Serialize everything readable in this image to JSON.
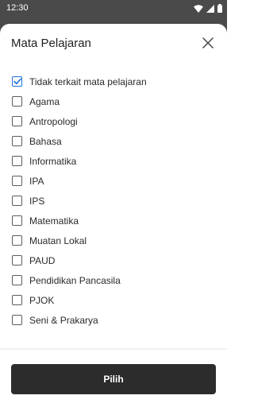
{
  "status_bar": {
    "time": "12:30",
    "icons": [
      "wifi-icon",
      "signal-icon",
      "battery-icon"
    ]
  },
  "sheet": {
    "title": "Mata Pelajaran",
    "close_icon": "close-icon"
  },
  "options": [
    {
      "label": "Tidak terkait mata pelajaran",
      "checked": true
    },
    {
      "label": "Agama",
      "checked": false
    },
    {
      "label": "Antropologi",
      "checked": false
    },
    {
      "label": "Bahasa",
      "checked": false
    },
    {
      "label": "Informatika",
      "checked": false
    },
    {
      "label": "IPA",
      "checked": false
    },
    {
      "label": "IPS",
      "checked": false
    },
    {
      "label": "Matematika",
      "checked": false
    },
    {
      "label": "Muatan Lokal",
      "checked": false
    },
    {
      "label": "PAUD",
      "checked": false
    },
    {
      "label": "Pendidikan Pancasila",
      "checked": false
    },
    {
      "label": "PJOK",
      "checked": false
    },
    {
      "label": "Seni & Prakarya",
      "checked": false
    }
  ],
  "footer": {
    "submit_label": "Pilih"
  },
  "colors": {
    "accent": "#1e6ee0",
    "button_bg": "#2c2c2c",
    "overlay": "#4a4a4a"
  }
}
